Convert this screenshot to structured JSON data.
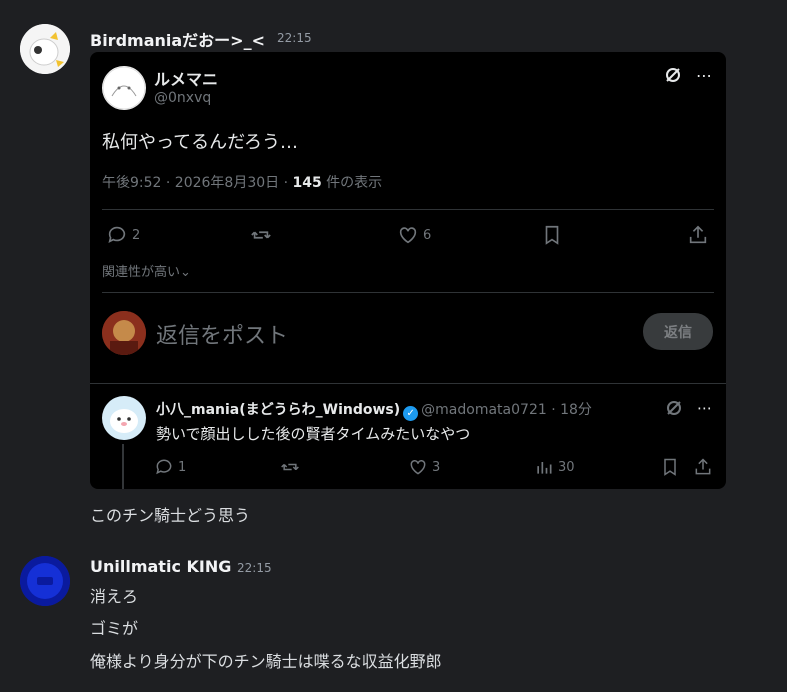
{
  "messages": [
    {
      "username": "Birdmaniaだおー>_<",
      "timestamp": "22:15",
      "embed": {
        "author_name": "ルメマニ",
        "author_handle": "@0nxvq",
        "body": "私何やってるんだろう…",
        "meta_time": "午後9:52 · 2026年8月30日 · ",
        "views_count": "145",
        "views_label": " 件の表示",
        "replies_count": "2",
        "likes_count": "6",
        "relevance_label": "関連性が高い",
        "reply_placeholder": "返信をポスト",
        "reply_button": "返信",
        "quoted": {
          "name": "小八_mania(まどうらわ_Windows)",
          "handle": "@madomata0721",
          "time": "· 18分",
          "body": "勢いで顔出しした後の賢者タイムみたいなやつ",
          "replies_count": "1",
          "likes_count": "3",
          "views_count": "30"
        }
      },
      "text": "このチン騎士どう思う"
    },
    {
      "username": "Unillmatic KING",
      "timestamp": "22:15",
      "lines": [
        "消えろ",
        "ゴミが",
        "俺様より身分が下のチン騎士は喋るな収益化野郎"
      ]
    }
  ],
  "colors": {
    "background": "#1e1f22",
    "embed_background": "#000000",
    "verified_blue": "#1d9bf0",
    "muted_text": "#71767b"
  }
}
